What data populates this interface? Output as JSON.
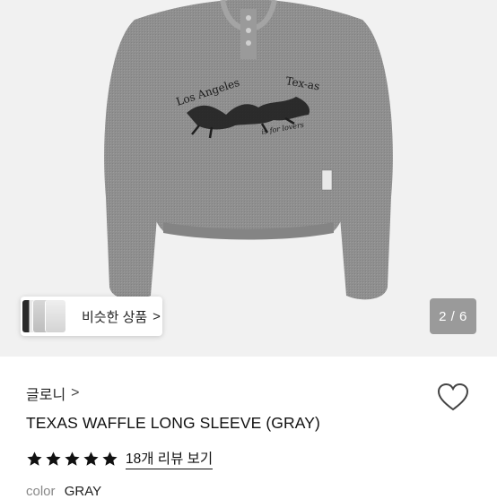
{
  "gallery": {
    "similar_button_label": "비슷한 상품",
    "similar_button_chevron": ">",
    "image_counter": "2 / 6",
    "print_text_1": "Los Angeles",
    "print_text_2": "Tex-as",
    "print_text_3": "is for lovers"
  },
  "product": {
    "brand": "글로니",
    "brand_chevron": ">",
    "title": "TEXAS WAFFLE LONG SLEEVE (GRAY)",
    "rating_stars": 5,
    "reviews_link": "18개 리뷰 보기",
    "color_label": "color",
    "color_value": "GRAY"
  },
  "colors": {
    "gallery_bg": "#f1f1f1",
    "shirt": "#8e8e8e",
    "star": "#111111"
  },
  "icons": [
    "heart-icon",
    "star-icon",
    "chevron-right-icon"
  ]
}
